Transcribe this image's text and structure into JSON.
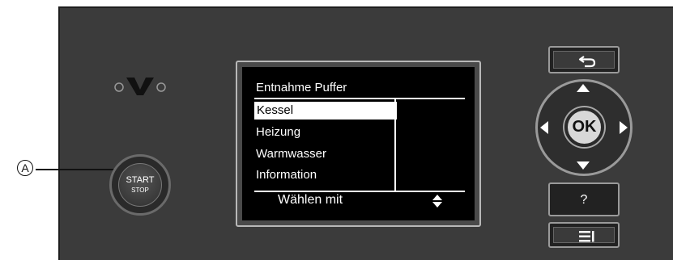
{
  "callout": {
    "label": "A"
  },
  "start_button": {
    "line1": "START",
    "line2": "STOP"
  },
  "display": {
    "title": "Entnahme Puffer",
    "menu_items": [
      "Kessel",
      "Heizung",
      "Warmwasser",
      "Information"
    ],
    "selected_index": 0,
    "footer": "Wählen mit"
  },
  "keys": {
    "ok_label": "OK",
    "help_label": "?"
  },
  "colors": {
    "panel": "#3b3b3b",
    "screen": "#000000",
    "text": "#ffffff",
    "ok_button": "#d8d8d8"
  },
  "icons": {
    "logo": "viessmann-v-logo",
    "back": "back-arrow-icon",
    "menu": "menu-lines-icon",
    "updown": "up-down-arrows-icon"
  }
}
